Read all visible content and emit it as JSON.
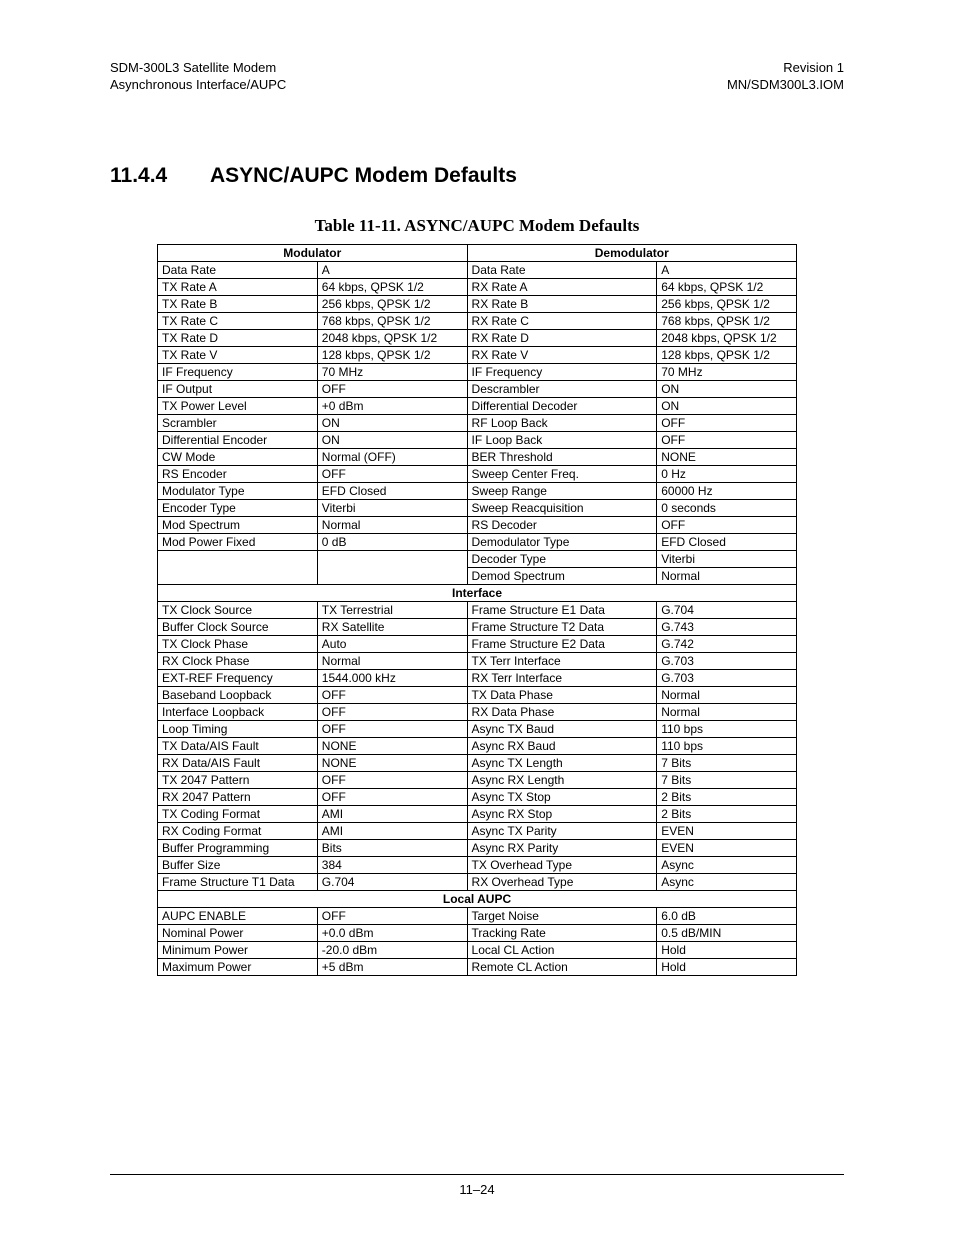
{
  "header": {
    "left_line1": "SDM-300L3 Satellite Modem",
    "left_line2": "Asynchronous Interface/AUPC",
    "right_line1": "Revision 1",
    "right_line2": "MN/SDM300L3.IOM"
  },
  "section": {
    "number": "11.4.4",
    "title": "ASYNC/AUPC Modem Defaults"
  },
  "table": {
    "caption": "Table 11-11.  ASYNC/AUPC Modem Defaults",
    "heads": {
      "modulator": "Modulator",
      "demodulator": "Demodulator",
      "interface": "Interface",
      "local_aupc": "Local AUPC"
    },
    "mod_demod_rows": [
      [
        "Data Rate",
        "A",
        "Data Rate",
        "A"
      ],
      [
        "TX Rate A",
        "64 kbps, QPSK 1/2",
        "RX Rate A",
        "64 kbps, QPSK 1/2"
      ],
      [
        "TX Rate B",
        "256 kbps, QPSK 1/2",
        "RX Rate B",
        "256 kbps, QPSK 1/2"
      ],
      [
        "TX Rate C",
        "768 kbps, QPSK 1/2",
        "RX Rate C",
        "768 kbps, QPSK 1/2"
      ],
      [
        "TX Rate D",
        "2048 kbps, QPSK 1/2",
        "RX Rate D",
        "2048 kbps, QPSK 1/2"
      ],
      [
        "TX Rate V",
        "128 kbps, QPSK 1/2",
        "RX Rate V",
        "128 kbps, QPSK 1/2"
      ],
      [
        "IF Frequency",
        "70 MHz",
        "IF Frequency",
        "70 MHz"
      ],
      [
        "IF Output",
        "OFF",
        "Descrambler",
        "ON"
      ],
      [
        "TX Power Level",
        "+0 dBm",
        "Differential Decoder",
        "ON"
      ],
      [
        "Scrambler",
        "ON",
        "RF Loop Back",
        "OFF"
      ],
      [
        "Differential Encoder",
        "ON",
        "IF Loop Back",
        "OFF"
      ],
      [
        "CW Mode",
        "Normal (OFF)",
        "BER Threshold",
        "NONE"
      ],
      [
        "RS Encoder",
        "OFF",
        "Sweep Center Freq.",
        "0 Hz"
      ],
      [
        "Modulator Type",
        "EFD Closed",
        "Sweep Range",
        "60000 Hz"
      ],
      [
        "Encoder Type",
        "Viterbi",
        "Sweep Reacquisition",
        "0 seconds"
      ],
      [
        "Mod Spectrum",
        "Normal",
        "RS Decoder",
        "OFF"
      ],
      [
        "Mod Power Fixed",
        "0 dB",
        "Demodulator Type",
        "EFD Closed"
      ],
      [
        "",
        "",
        "Decoder Type",
        "Viterbi"
      ],
      [
        "",
        "",
        "Demod Spectrum",
        "Normal"
      ]
    ],
    "interface_rows": [
      [
        "TX Clock Source",
        "TX Terrestrial",
        "Frame Structure E1 Data",
        "G.704"
      ],
      [
        "Buffer Clock Source",
        "RX Satellite",
        "Frame Structure T2 Data",
        "G.743"
      ],
      [
        "TX Clock Phase",
        "Auto",
        "Frame Structure E2 Data",
        "G.742"
      ],
      [
        "RX Clock Phase",
        "Normal",
        "TX Terr Interface",
        "G.703"
      ],
      [
        "EXT-REF Frequency",
        "1544.000 kHz",
        "RX Terr Interface",
        "G.703"
      ],
      [
        "Baseband Loopback",
        "OFF",
        "TX Data Phase",
        "Normal"
      ],
      [
        "Interface Loopback",
        "OFF",
        "RX Data Phase",
        "Normal"
      ],
      [
        "Loop Timing",
        "OFF",
        "Async TX Baud",
        "110 bps"
      ],
      [
        "TX Data/AIS Fault",
        "NONE",
        "Async RX Baud",
        "110 bps"
      ],
      [
        "RX Data/AIS Fault",
        "NONE",
        "Async TX Length",
        "7 Bits"
      ],
      [
        "TX 2047 Pattern",
        "OFF",
        "Async RX Length",
        "7 Bits"
      ],
      [
        "RX 2047 Pattern",
        "OFF",
        "Async TX Stop",
        "2 Bits"
      ],
      [
        "TX Coding Format",
        "AMI",
        "Async RX Stop",
        "2 Bits"
      ],
      [
        "RX Coding Format",
        "AMI",
        "Async TX Parity",
        "EVEN"
      ],
      [
        "Buffer Programming",
        "Bits",
        "Async RX Parity",
        "EVEN"
      ],
      [
        "Buffer Size",
        "384",
        "TX Overhead Type",
        "Async"
      ],
      [
        "Frame Structure T1 Data",
        "G.704",
        "RX Overhead Type",
        "Async"
      ]
    ],
    "local_aupc_rows": [
      [
        "AUPC ENABLE",
        "OFF",
        "Target Noise",
        "6.0 dB"
      ],
      [
        "Nominal Power",
        "+0.0 dBm",
        "Tracking Rate",
        "0.5 dB/MIN"
      ],
      [
        "Minimum Power",
        "-20.0 dBm",
        "Local CL Action",
        "Hold"
      ],
      [
        "Maximum Power",
        "+5 dBm",
        "Remote CL Action",
        "Hold"
      ]
    ]
  },
  "footer": {
    "page": "11–24"
  }
}
